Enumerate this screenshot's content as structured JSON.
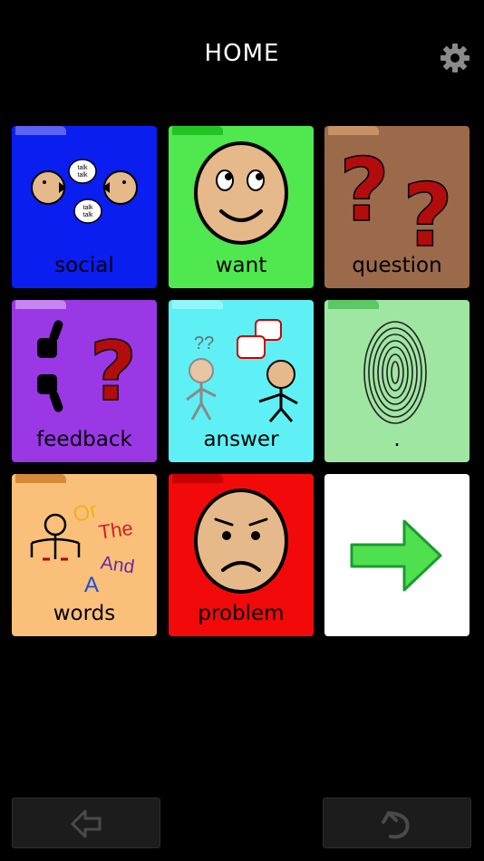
{
  "header": {
    "title": "HOME",
    "settings_icon": "gear-icon"
  },
  "tiles": [
    {
      "label": "social",
      "color": "#0a1ef0",
      "tab": "#5a63f2",
      "icon": "talking-heads-icon"
    },
    {
      "label": "want",
      "color": "#4fe84f",
      "tab": "#22c322",
      "icon": "smiling-face-icon"
    },
    {
      "label": "question",
      "color": "#9b6a4a",
      "tab": "#c89066",
      "icon": "question-marks-icon"
    },
    {
      "label": "feedback",
      "color": "#9a38e6",
      "tab": "#c784f4",
      "icon": "thumbs-up-down-icon"
    },
    {
      "label": "answer",
      "color": "#5ef0f4",
      "tab": "#8ff7f9",
      "icon": "two-people-talking-icon"
    },
    {
      "label": ".",
      "color": "#9fe6a2",
      "tab": "#5cc863",
      "icon": "fingerprint-icon"
    },
    {
      "label": "words",
      "color": "#fac07a",
      "tab": "#d68a3c",
      "icon": "words-icon"
    },
    {
      "label": "problem",
      "color": "#f20a0a",
      "tab": "#c90000",
      "icon": "worried-face-icon"
    },
    {
      "label": "",
      "color": "#ffffff",
      "tab": "#ffffff",
      "icon": "green-arrow-right-icon"
    }
  ],
  "words_art": {
    "w1": "Or",
    "w2": "The",
    "w3": "And",
    "w4": "A"
  },
  "bottom_nav": {
    "back_icon": "back-arrow-icon",
    "undo_icon": "undo-icon"
  }
}
